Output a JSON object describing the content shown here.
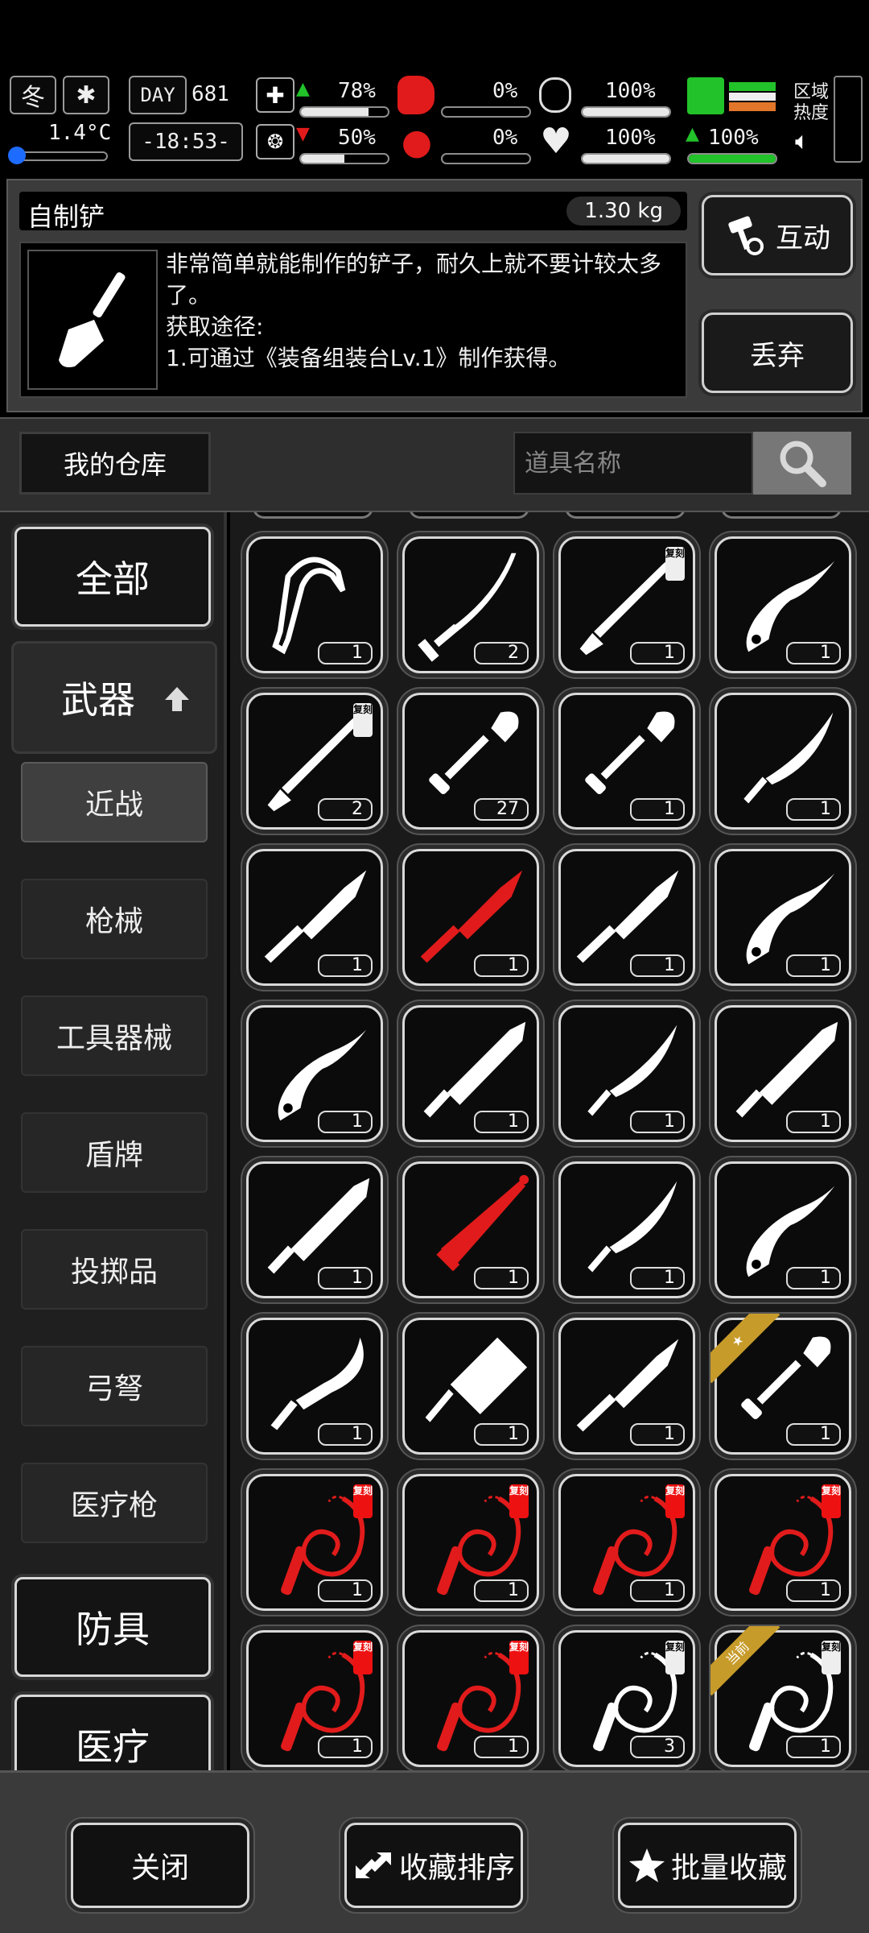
{
  "status": {
    "season": "冬",
    "temperature": "1.4°C",
    "day_label": "DAY",
    "day": "681",
    "time": "-18:53-",
    "health_pct": "78%",
    "stomach_pct": "0%",
    "stamina_pct": "100%",
    "sanity_pct": "50%",
    "blood_pct": "0%",
    "heart_pct": "100%",
    "speed_pct": "100%",
    "zone_heat_label": "区域\n热度",
    "health_value": 0.78,
    "sanity_value": 0.5,
    "stomach_value": 0.0,
    "blood_value": 0.0,
    "stamina_value": 1.0,
    "heart_value": 1.0,
    "speed_value": 1.0
  },
  "item": {
    "name": "自制铲",
    "weight": "1.30 kg",
    "description": "非常简单就能制作的铲子，耐久上就不要计较太多了。\n获取途径:\n1.可通过《装备组装台Lv.1》制作获得。",
    "interact_label": "互动",
    "discard_label": "丢弃"
  },
  "search": {
    "warehouse_label": "我的仓库",
    "placeholder": "道具名称"
  },
  "sidebar": {
    "main": [
      {
        "label": "全部"
      },
      {
        "label": "武器"
      },
      {
        "label": "防具"
      },
      {
        "label": "医疗"
      }
    ],
    "sub": [
      {
        "label": "近战"
      },
      {
        "label": "枪械"
      },
      {
        "label": "工具器械"
      },
      {
        "label": "盾牌"
      },
      {
        "label": "投掷品"
      },
      {
        "label": "弓弩"
      },
      {
        "label": "医疗枪"
      }
    ]
  },
  "grid": {
    "tag_text": "复刻",
    "ribbon_current": "当前",
    "items": [
      {
        "icon": "ice-axe-icon",
        "qty": "1",
        "color": "#ffffff",
        "tag": false
      },
      {
        "icon": "katana-icon",
        "qty": "2",
        "color": "#ffffff",
        "tag": false
      },
      {
        "icon": "spear-icon",
        "qty": "1",
        "color": "#ffffff",
        "tag": true
      },
      {
        "icon": "karambit-icon",
        "qty": "1",
        "color": "#ffffff",
        "tag": false
      },
      {
        "icon": "spear-icon",
        "qty": "2",
        "color": "#ffffff",
        "tag": true
      },
      {
        "icon": "shovel-icon",
        "qty": "27",
        "color": "#ffffff",
        "tag": false
      },
      {
        "icon": "shovel-icon",
        "qty": "1",
        "color": "#ffffff",
        "tag": false
      },
      {
        "icon": "curved-blade-icon",
        "qty": "1",
        "color": "#ffffff",
        "tag": false
      },
      {
        "icon": "combat-knife-icon",
        "qty": "1",
        "color": "#ffffff",
        "tag": false
      },
      {
        "icon": "combat-knife-icon",
        "qty": "1",
        "color": "#e11b1b",
        "tag": false
      },
      {
        "icon": "combat-knife-icon",
        "qty": "1",
        "color": "#ffffff",
        "tag": false
      },
      {
        "icon": "karambit-icon",
        "qty": "1",
        "color": "#ffffff",
        "tag": false
      },
      {
        "icon": "karambit-icon",
        "qty": "1",
        "color": "#ffffff",
        "tag": false
      },
      {
        "icon": "machete-icon",
        "qty": "1",
        "color": "#ffffff",
        "tag": false
      },
      {
        "icon": "curved-blade-icon",
        "qty": "1",
        "color": "#ffffff",
        "tag": false
      },
      {
        "icon": "machete-icon",
        "qty": "1",
        "color": "#ffffff",
        "tag": false
      },
      {
        "icon": "machete-icon",
        "qty": "1",
        "color": "#ffffff",
        "tag": false
      },
      {
        "icon": "broadsword-icon",
        "qty": "1",
        "color": "#e11b1b",
        "tag": false
      },
      {
        "icon": "curved-blade-icon",
        "qty": "1",
        "color": "#ffffff",
        "tag": false
      },
      {
        "icon": "karambit-icon",
        "qty": "1",
        "color": "#ffffff",
        "tag": false
      },
      {
        "icon": "kukri-icon",
        "qty": "1",
        "color": "#ffffff",
        "tag": false
      },
      {
        "icon": "cleaver-icon",
        "qty": "1",
        "color": "#ffffff",
        "tag": false
      },
      {
        "icon": "combat-knife-icon",
        "qty": "1",
        "color": "#ffffff",
        "tag": false
      },
      {
        "icon": "shovel-icon",
        "qty": "1",
        "color": "#ffffff",
        "tag": false,
        "star_ribbon": true
      },
      {
        "icon": "whip-icon",
        "qty": "1",
        "color": "#e11b1b",
        "tag": true
      },
      {
        "icon": "whip-icon",
        "qty": "1",
        "color": "#e11b1b",
        "tag": true
      },
      {
        "icon": "whip-icon",
        "qty": "1",
        "color": "#e11b1b",
        "tag": true
      },
      {
        "icon": "whip-icon",
        "qty": "1",
        "color": "#e11b1b",
        "tag": true
      },
      {
        "icon": "whip-icon",
        "qty": "1",
        "color": "#e11b1b",
        "tag": true
      },
      {
        "icon": "whip-icon",
        "qty": "1",
        "color": "#e11b1b",
        "tag": true
      },
      {
        "icon": "whip-icon",
        "qty": "3",
        "color": "#ffffff",
        "tag": true
      },
      {
        "icon": "whip-icon",
        "qty": "1",
        "color": "#ffffff",
        "tag": true,
        "current_ribbon": true
      }
    ]
  },
  "bottom": {
    "close_label": "关闭",
    "sort_label": "收藏排序",
    "batch_label": "批量收藏"
  },
  "colors": {
    "accent_green": "#22c22a",
    "warning_red": "#e11b1b",
    "ribbon_gold": "#c79b2a"
  }
}
